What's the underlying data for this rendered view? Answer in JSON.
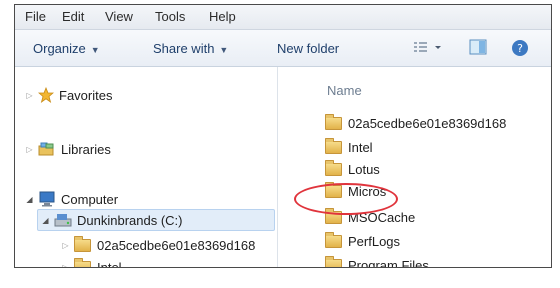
{
  "menu": [
    "File",
    "Edit",
    "View",
    "Tools",
    "Help"
  ],
  "toolbar": {
    "organize": "Organize",
    "share_with": "Share with",
    "new_folder": "New folder"
  },
  "nav": {
    "favorites": "Favorites",
    "libraries": "Libraries",
    "computer": "Computer",
    "drive": "Dunkinbrands (C:)",
    "children": [
      "02a5cedbe6e01e8369d168",
      "Intel"
    ]
  },
  "content": {
    "column_name": "Name",
    "items": [
      "02a5cedbe6e01e8369d168",
      "Intel",
      "Lotus",
      "Micros",
      "MSOCache",
      "PerfLogs",
      "Program Files"
    ]
  },
  "colors": {
    "highlight": "#e0343c",
    "selection": "#e2edf9",
    "folder": "#e2b24a"
  }
}
